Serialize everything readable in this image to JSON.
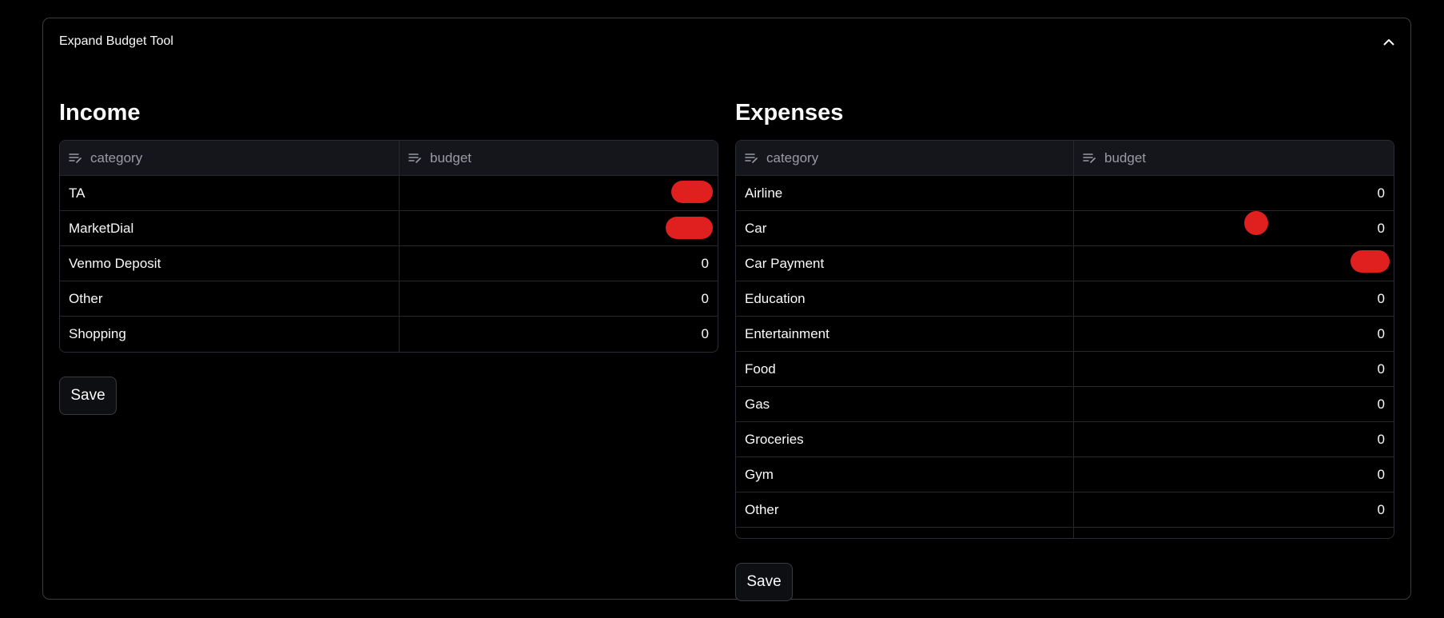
{
  "expander": {
    "title": "Expand Budget Tool",
    "icon": "chevron-up-icon"
  },
  "income": {
    "heading": "Income",
    "columns": [
      "category",
      "budget"
    ],
    "rows": [
      {
        "category": "TA",
        "budget": ""
      },
      {
        "category": "MarketDial",
        "budget": ""
      },
      {
        "category": "Venmo Deposit",
        "budget": "0"
      },
      {
        "category": "Other",
        "budget": "0"
      },
      {
        "category": "Shopping",
        "budget": "0"
      }
    ],
    "save_label": "Save"
  },
  "expenses": {
    "heading": "Expenses",
    "columns": [
      "category",
      "budget"
    ],
    "rows": [
      {
        "category": "Airline",
        "budget": "0"
      },
      {
        "category": "Car",
        "budget": "0"
      },
      {
        "category": "Car Payment",
        "budget": ""
      },
      {
        "category": "Education",
        "budget": "0"
      },
      {
        "category": "Entertainment",
        "budget": "0"
      },
      {
        "category": "Food",
        "budget": "0"
      },
      {
        "category": "Gas",
        "budget": "0"
      },
      {
        "category": "Groceries",
        "budget": "0"
      },
      {
        "category": "Gym",
        "budget": "0"
      },
      {
        "category": "Other",
        "budget": "0"
      }
    ],
    "save_label": "Save"
  },
  "colors": {
    "background": "#000000",
    "border": "#3a3b40",
    "header_bg": "#15161b",
    "redaction": "#e01f1f",
    "text": "#fafafa",
    "muted": "#9a9ba3"
  }
}
